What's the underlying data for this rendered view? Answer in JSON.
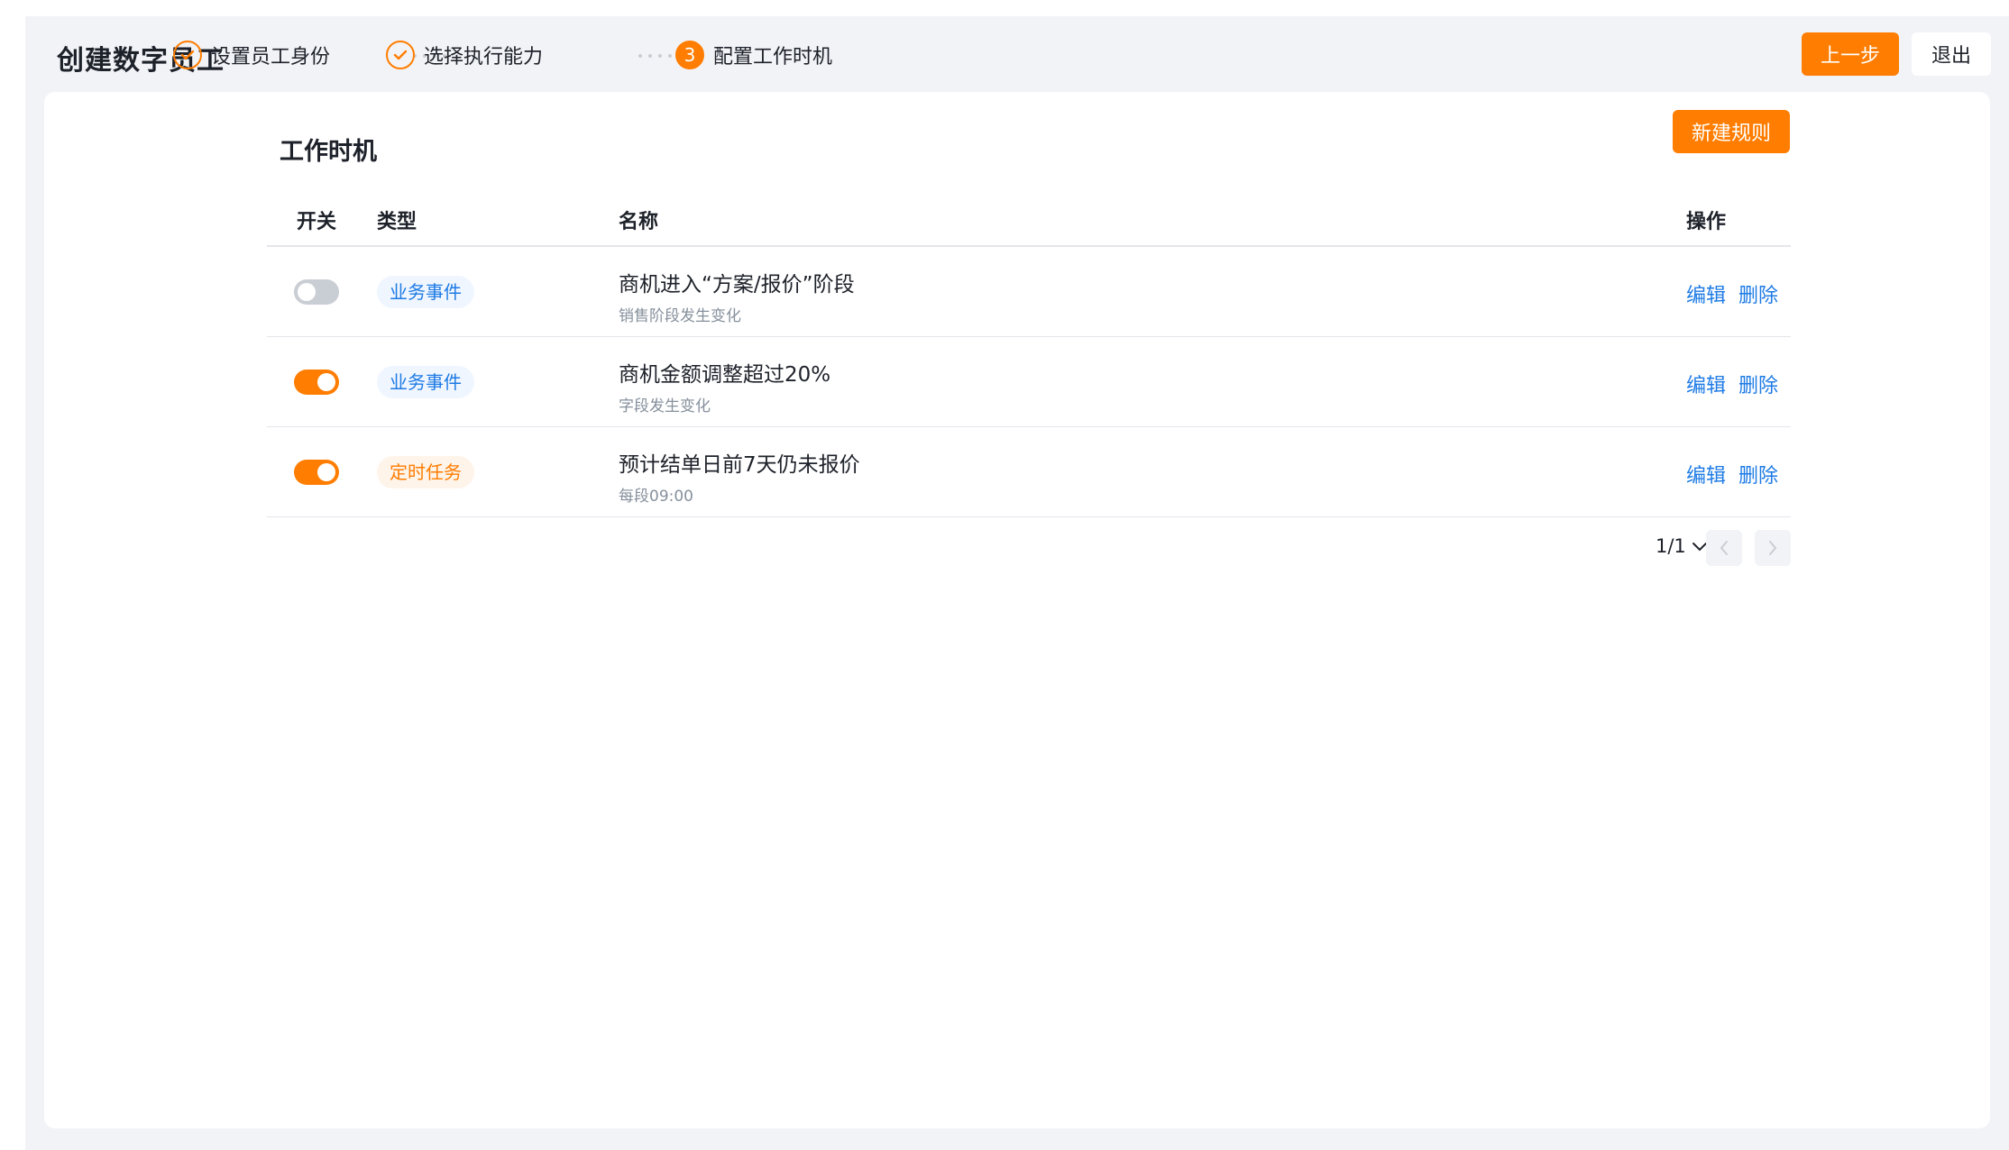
{
  "header": {
    "title": "创建数字员工",
    "steps": [
      {
        "label": "设置员工身份",
        "status": "done"
      },
      {
        "label": "选择执行能力",
        "status": "done"
      },
      {
        "label": "配置工作时机",
        "status": "current",
        "number": "3"
      }
    ],
    "prev_label": "上一步",
    "exit_label": "退出"
  },
  "section": {
    "title": "工作时机",
    "new_rule_label": "新建规则"
  },
  "table": {
    "columns": [
      "开关",
      "类型",
      "名称",
      "操作"
    ],
    "rows": [
      {
        "enabled": false,
        "type": "业务事件",
        "type_color": "blue",
        "name": "商机进入“方案/报价”阶段",
        "desc": "销售阶段发生变化",
        "edit": "编辑",
        "delete": "删除"
      },
      {
        "enabled": true,
        "type": "业务事件",
        "type_color": "blue",
        "name": "商机金额调整超过20%",
        "desc": "字段发生变化",
        "edit": "编辑",
        "delete": "删除"
      },
      {
        "enabled": true,
        "type": "定时任务",
        "type_color": "orange",
        "name": "预计结单日前7天仍未报价",
        "desc": "每段09:00",
        "edit": "编辑",
        "delete": "删除"
      }
    ]
  },
  "pagination": {
    "page": "1/1"
  },
  "colors": {
    "accent": "#ff7d00",
    "link": "#1e7be5",
    "background": "#f2f3f7"
  }
}
